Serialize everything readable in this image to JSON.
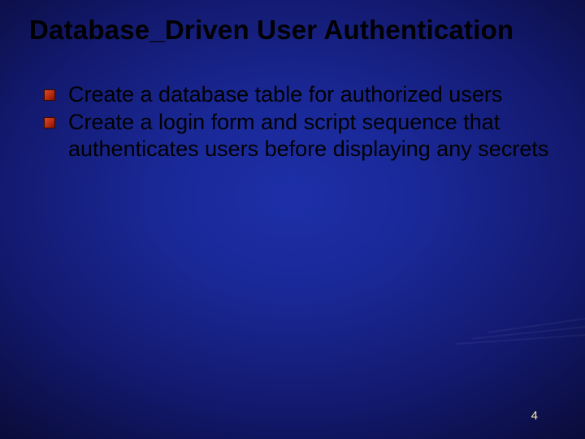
{
  "slide": {
    "title": "Database_Driven User Authentication",
    "bullets": [
      "Create a database table for authorized users",
      "Create a login form and script sequence that authenticates users before displaying any secrets"
    ],
    "page_number": "4"
  }
}
